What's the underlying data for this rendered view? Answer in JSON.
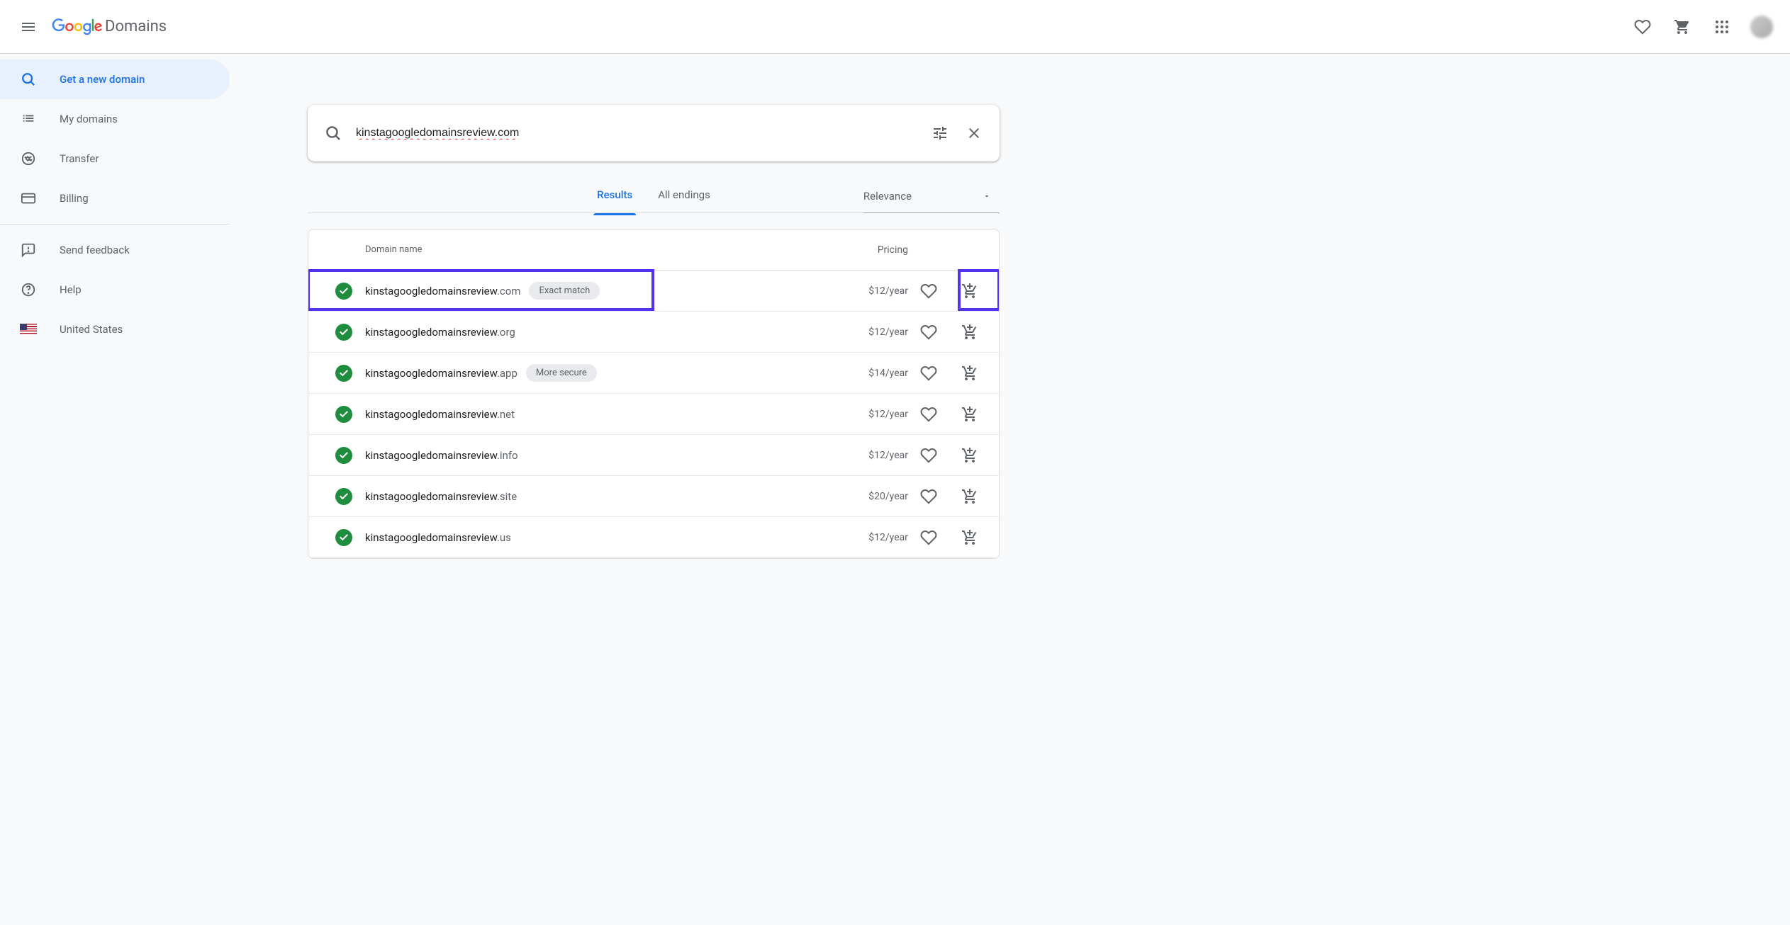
{
  "header": {
    "logo_suffix": "Domains"
  },
  "sidebar": {
    "items": [
      {
        "label": "Get a new domain"
      },
      {
        "label": "My domains"
      },
      {
        "label": "Transfer"
      },
      {
        "label": "Billing"
      },
      {
        "label": "Send feedback"
      },
      {
        "label": "Help"
      },
      {
        "label": "United States"
      }
    ]
  },
  "search": {
    "value": "kinstagoogledomainsreview.com"
  },
  "tabs": {
    "results": "Results",
    "all_endings": "All endings"
  },
  "sort": {
    "label": "Relevance"
  },
  "table": {
    "col_name": "Domain name",
    "col_price": "Pricing"
  },
  "rows": [
    {
      "name": "kinstagoogledomainsreview",
      "tld": ".com",
      "badge": "Exact match",
      "price": "$12/year",
      "highlight": true
    },
    {
      "name": "kinstagoogledomainsreview",
      "tld": ".org",
      "badge": null,
      "price": "$12/year"
    },
    {
      "name": "kinstagoogledomainsreview",
      "tld": ".app",
      "badge": "More secure",
      "price": "$14/year"
    },
    {
      "name": "kinstagoogledomainsreview",
      "tld": ".net",
      "badge": null,
      "price": "$12/year"
    },
    {
      "name": "kinstagoogledomainsreview",
      "tld": ".info",
      "badge": null,
      "price": "$12/year"
    },
    {
      "name": "kinstagoogledomainsreview",
      "tld": ".site",
      "badge": null,
      "price": "$20/year"
    },
    {
      "name": "kinstagoogledomainsreview",
      "tld": ".us",
      "badge": null,
      "price": "$12/year"
    }
  ]
}
